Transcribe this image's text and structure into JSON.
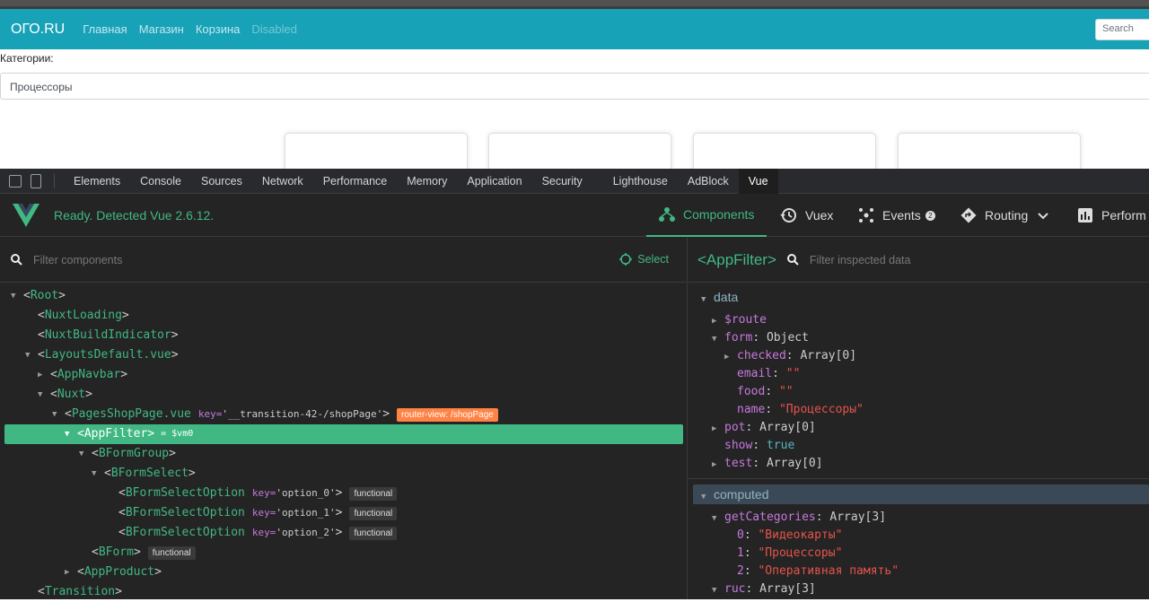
{
  "site": {
    "brand": "ОГО.RU",
    "nav": [
      "Главная",
      "Магазин",
      "Корзина"
    ],
    "nav_disabled": "Disabled",
    "search_placeholder": "Search",
    "categories_label": "Категории:",
    "select_value": "Процессоры"
  },
  "devtools": {
    "tabs": [
      "Elements",
      "Console",
      "Sources",
      "Network",
      "Performance",
      "Memory",
      "Application",
      "Security",
      "Lighthouse",
      "AdBlock",
      "Vue"
    ],
    "active_tab": "Vue"
  },
  "vue": {
    "status": "Ready. Detected Vue 2.6.12.",
    "tabs": {
      "components": "Components",
      "vuex": "Vuex",
      "events": "Events",
      "events_badge": "2",
      "routing": "Routing",
      "performance": "Perform"
    },
    "filter_placeholder": "Filter components",
    "select_label": "Select",
    "inspected_name": "<AppFilter>",
    "inspect_placeholder": "Filter inspected data"
  },
  "tree": {
    "root": "Root",
    "nuxt_loading": "NuxtLoading",
    "nuxt_build": "NuxtBuildIndicator",
    "layouts": "LayoutsDefault.vue",
    "app_navbar": "AppNavbar",
    "nuxt": "Nuxt",
    "pages_shop": "PagesShopPage.vue",
    "pages_shop_key_label": "key=",
    "pages_shop_key": "'__transition-42-/shopPage'",
    "router_tag": "router-view: /shopPage",
    "app_filter": "AppFilter",
    "app_filter_vm": "= $vm0",
    "bform_group": "BFormGroup",
    "bform_select": "BFormSelect",
    "options": [
      {
        "name": "BFormSelectOption",
        "key_label": "key=",
        "key": "'option_0'",
        "tag": "functional"
      },
      {
        "name": "BFormSelectOption",
        "key_label": "key=",
        "key": "'option_1'",
        "tag": "functional"
      },
      {
        "name": "BFormSelectOption",
        "key_label": "key=",
        "key": "'option_2'",
        "tag": "functional"
      }
    ],
    "bform": "BForm",
    "bform_tag": "functional",
    "app_product": "AppProduct",
    "transition": "Transition"
  },
  "inspector": {
    "data_label": "data",
    "route": "$route",
    "form_key": "form",
    "form_val": "Object",
    "checked_key": "checked",
    "checked_val": "Array[0]",
    "email_key": "email",
    "email_val": "\"\"",
    "food_key": "food",
    "food_val": "\"\"",
    "name_key": "name",
    "name_val": "\"Процессоры\"",
    "pot_key": "pot",
    "pot_val": "Array[0]",
    "show_key": "show",
    "show_val": "true",
    "test_key": "test",
    "test_val": "Array[0]",
    "computed_label": "computed",
    "getcat_key": "getCategories",
    "getcat_val": "Array[3]",
    "items": [
      {
        "idx": "0",
        "val": "\"Видеокарты\""
      },
      {
        "idx": "1",
        "val": "\"Процессоры\""
      },
      {
        "idx": "2",
        "val": "\"Оперативная память\""
      }
    ],
    "ruc_key": "ruc",
    "ruc_val": "Array[3]"
  }
}
